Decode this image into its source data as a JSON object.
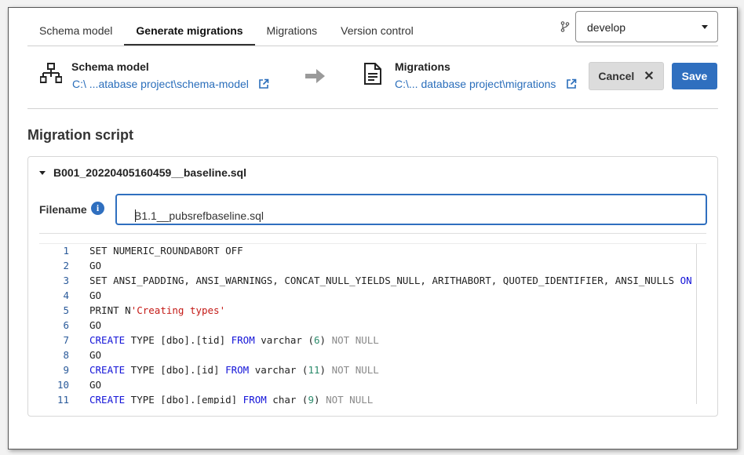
{
  "tabs": [
    {
      "label": "Schema model",
      "active": false
    },
    {
      "label": "Generate migrations",
      "active": true
    },
    {
      "label": "Migrations",
      "active": false
    },
    {
      "label": "Version control",
      "active": false
    }
  ],
  "branch": {
    "value": "develop"
  },
  "source": {
    "title": "Schema model",
    "path": "C:\\ ...atabase project\\schema-model"
  },
  "target": {
    "title": "Migrations",
    "path": "C:\\... database project\\migrations"
  },
  "actions": {
    "cancel": "Cancel",
    "save": "Save"
  },
  "section_title": "Migration script",
  "script": {
    "name": "B001_20220405160459__baseline.sql",
    "filename_label": "Filename",
    "filename_value": "B1.1__pubsrefbaseline.sql"
  },
  "code": [
    {
      "n": "1",
      "tokens": [
        [
          "SET NUMERIC_ROUNDABORT OFF",
          "plain"
        ]
      ]
    },
    {
      "n": "2",
      "tokens": [
        [
          "GO",
          "plain"
        ]
      ]
    },
    {
      "n": "3",
      "tokens": [
        [
          "SET ANSI_PADDING, ANSI_WARNINGS, CONCAT_NULL_YIELDS_NULL, ARITHABORT, QUOTED_IDENTIFIER, ANSI_NULLS ",
          "plain"
        ],
        [
          "ON",
          "kw"
        ]
      ]
    },
    {
      "n": "4",
      "tokens": [
        [
          "GO",
          "plain"
        ]
      ]
    },
    {
      "n": "5",
      "tokens": [
        [
          "PRINT N",
          "plain"
        ],
        [
          "'Creating types'",
          "str"
        ]
      ]
    },
    {
      "n": "6",
      "tokens": [
        [
          "GO",
          "plain"
        ]
      ]
    },
    {
      "n": "7",
      "tokens": [
        [
          "CREATE",
          "kw"
        ],
        [
          " TYPE [dbo].[tid] ",
          "plain"
        ],
        [
          "FROM",
          "kw"
        ],
        [
          " varchar (",
          "plain"
        ],
        [
          "6",
          "num"
        ],
        [
          ") ",
          "plain"
        ],
        [
          "NOT NULL",
          "gray"
        ]
      ]
    },
    {
      "n": "8",
      "tokens": [
        [
          "GO",
          "plain"
        ]
      ]
    },
    {
      "n": "9",
      "tokens": [
        [
          "CREATE",
          "kw"
        ],
        [
          " TYPE [dbo].[id] ",
          "plain"
        ],
        [
          "FROM",
          "kw"
        ],
        [
          " varchar (",
          "plain"
        ],
        [
          "11",
          "num"
        ],
        [
          ") ",
          "plain"
        ],
        [
          "NOT NULL",
          "gray"
        ]
      ]
    },
    {
      "n": "10",
      "tokens": [
        [
          "GO",
          "plain"
        ]
      ]
    },
    {
      "n": "11",
      "tokens": [
        [
          "CREATE",
          "kw"
        ],
        [
          " TYPE [dbo].[empid] ",
          "plain"
        ],
        [
          "FROM",
          "kw"
        ],
        [
          " char (",
          "plain"
        ],
        [
          "9",
          "num"
        ],
        [
          ") ",
          "plain"
        ],
        [
          "NOT NULL",
          "gray"
        ]
      ]
    }
  ]
}
